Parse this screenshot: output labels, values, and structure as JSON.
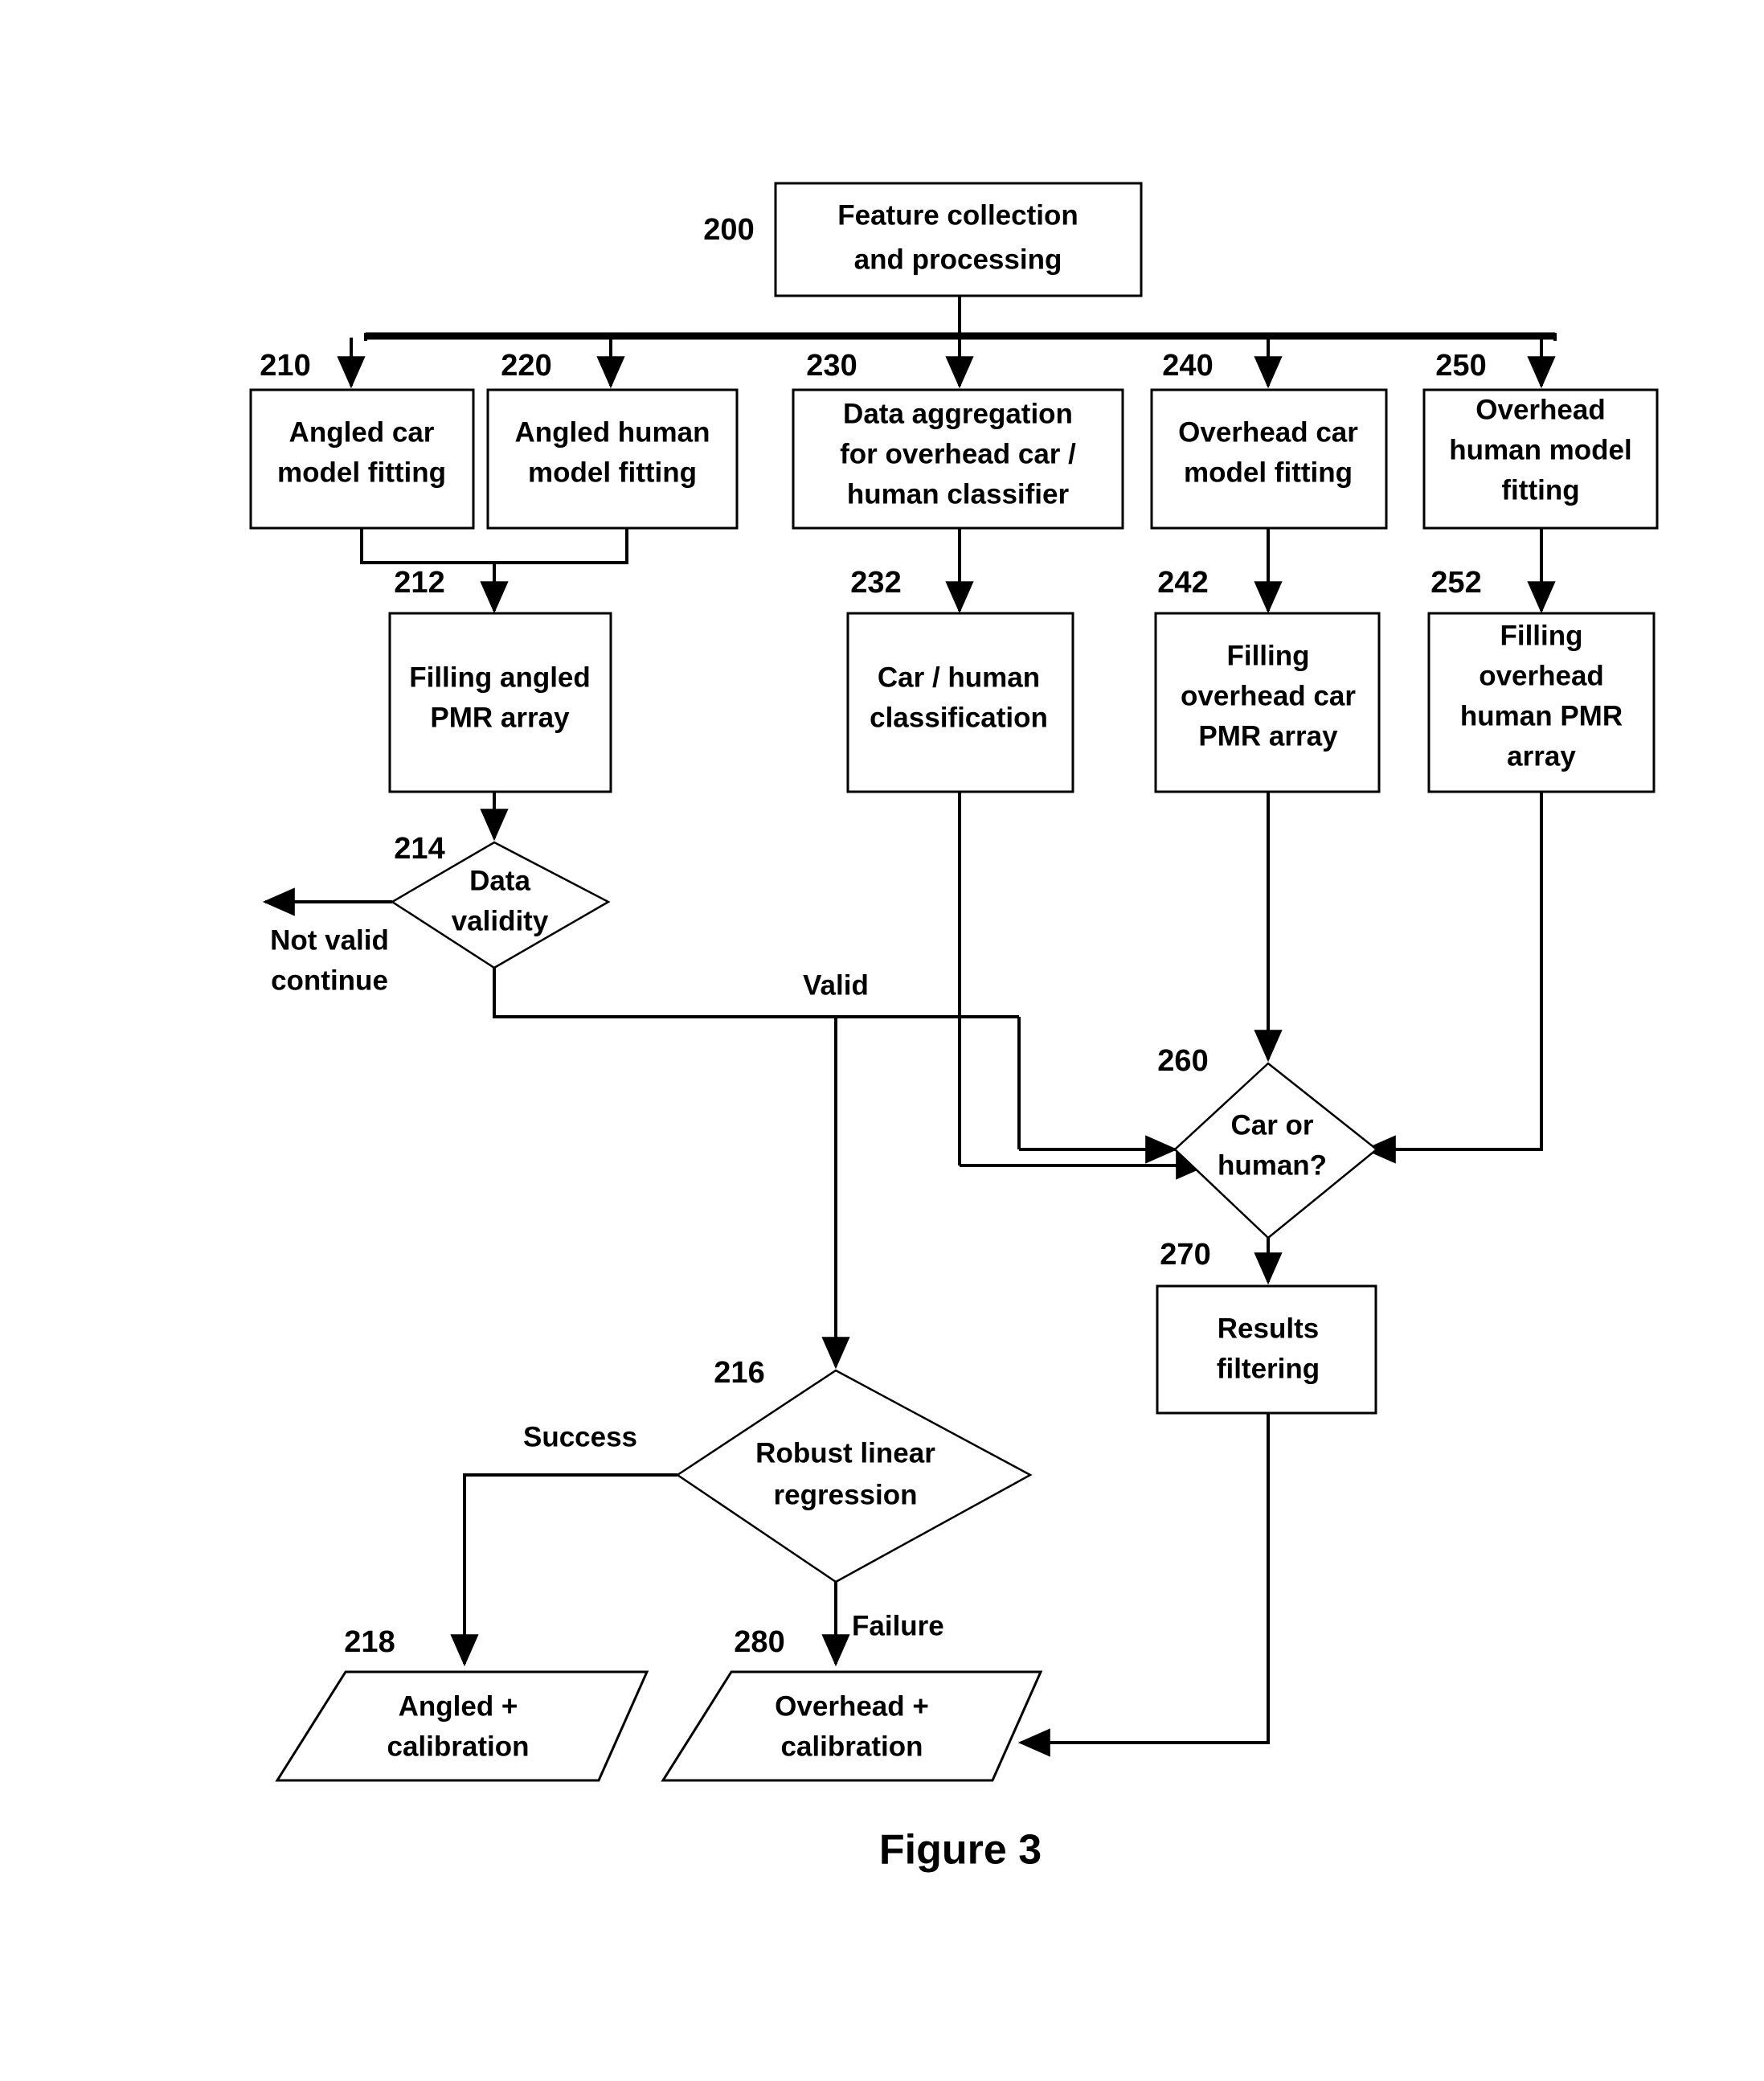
{
  "figure": {
    "caption": "Figure 3"
  },
  "nodes": [
    {
      "ref": "200",
      "type": "process",
      "lines": [
        "Feature collection",
        "and processing"
      ]
    },
    {
      "ref": "210",
      "type": "process",
      "lines": [
        "Angled car",
        "model fitting"
      ]
    },
    {
      "ref": "220",
      "type": "process",
      "lines": [
        "Angled human",
        "model fitting"
      ]
    },
    {
      "ref": "230",
      "type": "process",
      "lines": [
        "Data aggregation",
        "for overhead car /",
        "human classifier"
      ]
    },
    {
      "ref": "240",
      "type": "process",
      "lines": [
        "Overhead car",
        "model fitting"
      ]
    },
    {
      "ref": "250",
      "type": "process",
      "lines": [
        "Overhead",
        "human model",
        "fitting"
      ]
    },
    {
      "ref": "212",
      "type": "process",
      "lines": [
        "Filling angled",
        "PMR array"
      ]
    },
    {
      "ref": "232",
      "type": "process",
      "lines": [
        "Car / human",
        "classification"
      ]
    },
    {
      "ref": "242",
      "type": "process",
      "lines": [
        "Filling",
        "overhead car",
        "PMR array"
      ]
    },
    {
      "ref": "252",
      "type": "process",
      "lines": [
        "Filling",
        "overhead",
        "human PMR",
        "array"
      ]
    },
    {
      "ref": "214",
      "type": "decision",
      "lines": [
        "Data",
        "validity"
      ]
    },
    {
      "ref": "260",
      "type": "decision",
      "lines": [
        "Car or",
        "human?"
      ]
    },
    {
      "ref": "270",
      "type": "process",
      "lines": [
        "Results",
        "filtering"
      ]
    },
    {
      "ref": "216",
      "type": "decision",
      "lines": [
        "Robust linear",
        "regression"
      ]
    },
    {
      "ref": "218",
      "type": "data",
      "lines": [
        "Angled +",
        "calibration"
      ]
    },
    {
      "ref": "280",
      "type": "data",
      "lines": [
        "Overhead +",
        "calibration"
      ]
    }
  ],
  "edge_labels": {
    "not_valid": [
      "Not valid",
      "continue"
    ],
    "valid": "Valid",
    "success": "Success",
    "failure": "Failure"
  },
  "colors": {
    "stroke": "#000000",
    "fill": "#ffffff"
  }
}
